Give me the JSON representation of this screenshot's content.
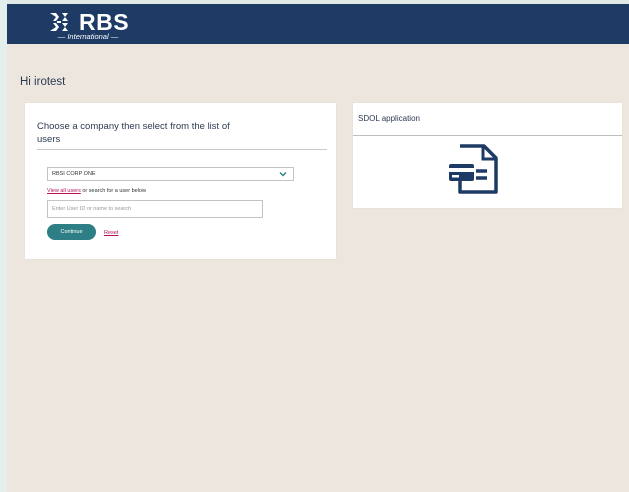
{
  "brand": {
    "name": "RBS",
    "subtitle": "— International —",
    "colors": {
      "header": "#1e3b66",
      "accent": "#2d7f85",
      "link": "#b4135a"
    }
  },
  "greeting": "Hi irotest",
  "company_card": {
    "title": "Choose a company then select from the list of users",
    "select": {
      "value": "RBSI CORP ONE"
    },
    "view_all_link": "View all users",
    "search_hint": " or search for a user below",
    "search": {
      "placeholder": "Enter User ID or name to search",
      "value": ""
    },
    "continue_label": "Continue",
    "reset_label": "Reset"
  },
  "sdol_card": {
    "title": "SDOL application",
    "icon": "document-card-icon"
  }
}
